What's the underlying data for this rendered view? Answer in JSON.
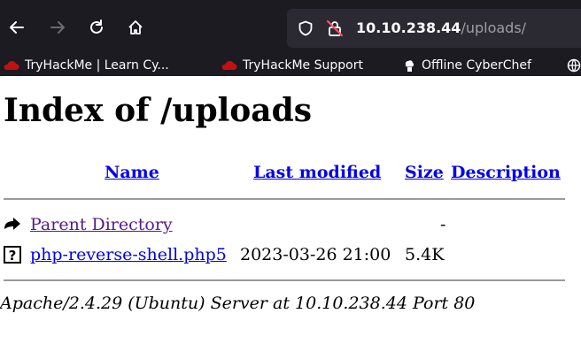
{
  "browser": {
    "url_host": "10.10.238.44",
    "url_path": "/uploads/",
    "bookmarks": [
      {
        "label": "TryHackMe | Learn Cy...",
        "icon": "tryhackme-icon"
      },
      {
        "label": "TryHackMe Support",
        "icon": "tryhackme-icon"
      },
      {
        "label": "Offline CyberChef",
        "icon": "cyberchef-icon"
      }
    ]
  },
  "page": {
    "title": "Index of /uploads",
    "columns": {
      "name": "Name",
      "last_modified": "Last modified",
      "size": "Size",
      "description": "Description"
    },
    "rows": [
      {
        "icon": "back-icon",
        "name": "Parent Directory",
        "modified": "",
        "size": "-",
        "description": ""
      },
      {
        "icon": "unknown-file-icon",
        "name": "php-reverse-shell.php5",
        "modified": "2023-03-26 21:00",
        "size": "5.4K",
        "description": ""
      }
    ],
    "address": "Apache/2.4.29 (Ubuntu) Server at 10.10.238.44 Port 80"
  },
  "colors": {
    "toolbar_bg": "#1c1b22",
    "urlbar_bg": "#2b2a33",
    "link_unvisited": "#0000ee",
    "link_visited": "#551a8b"
  }
}
